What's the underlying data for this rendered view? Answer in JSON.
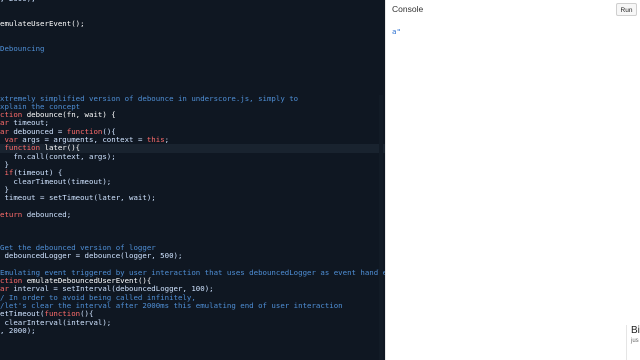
{
  "editor": {
    "lines": [
      {
        "parts": [
          {
            "t": ", 2000);",
            "c": "plain"
          }
        ]
      },
      {
        "parts": [
          {
            "t": "",
            "c": "plain"
          }
        ]
      },
      {
        "parts": [
          {
            "t": "",
            "c": "plain"
          }
        ]
      },
      {
        "parts": [
          {
            "t": "emulateUserEvent();",
            "c": "fn"
          }
        ]
      },
      {
        "parts": [
          {
            "t": "",
            "c": "plain"
          }
        ]
      },
      {
        "parts": [
          {
            "t": "",
            "c": "plain"
          }
        ]
      },
      {
        "parts": [
          {
            "t": "Debouncing",
            "c": "comment"
          }
        ]
      },
      {
        "parts": [
          {
            "t": "",
            "c": "plain"
          }
        ]
      },
      {
        "parts": [
          {
            "t": "",
            "c": "plain"
          }
        ]
      },
      {
        "parts": [
          {
            "t": "",
            "c": "plain"
          }
        ]
      },
      {
        "parts": [
          {
            "t": "",
            "c": "plain"
          }
        ]
      },
      {
        "parts": [
          {
            "t": "",
            "c": "plain"
          }
        ]
      },
      {
        "parts": [
          {
            "t": "xtremely simplified version of debounce in underscore.js, simply to",
            "c": "comment"
          }
        ]
      },
      {
        "parts": [
          {
            "t": "xplain the concept",
            "c": "comment"
          }
        ]
      },
      {
        "parts": [
          {
            "t": "ction ",
            "c": "keyword"
          },
          {
            "t": "debounce(fn, wait) {",
            "c": "fn"
          }
        ]
      },
      {
        "parts": [
          {
            "t": "ar ",
            "c": "keyword"
          },
          {
            "t": "timeout;",
            "c": "var"
          }
        ]
      },
      {
        "parts": [
          {
            "t": "ar ",
            "c": "keyword"
          },
          {
            "t": "debounced = ",
            "c": "var"
          },
          {
            "t": "function",
            "c": "keyword"
          },
          {
            "t": "(){",
            "c": "plain"
          }
        ]
      },
      {
        "parts": [
          {
            "t": " var ",
            "c": "keyword"
          },
          {
            "t": "args = arguments, context = ",
            "c": "var"
          },
          {
            "t": "this",
            "c": "keyword"
          },
          {
            "t": ";",
            "c": "plain"
          }
        ]
      },
      {
        "parts": [
          {
            "t": " function ",
            "c": "keyword"
          },
          {
            "t": "later(){",
            "c": "fn"
          }
        ],
        "active": true
      },
      {
        "parts": [
          {
            "t": "   fn.call(context, args);",
            "c": "var"
          }
        ]
      },
      {
        "parts": [
          {
            "t": " }",
            "c": "plain"
          }
        ]
      },
      {
        "parts": [
          {
            "t": " if",
            "c": "keyword"
          },
          {
            "t": "(timeout) {",
            "c": "var"
          }
        ]
      },
      {
        "parts": [
          {
            "t": "   clearTimeout(timeout);",
            "c": "var"
          }
        ]
      },
      {
        "parts": [
          {
            "t": " }",
            "c": "plain"
          }
        ]
      },
      {
        "parts": [
          {
            "t": " timeout = setTimeout(later, wait);",
            "c": "var"
          }
        ]
      },
      {
        "parts": [
          {
            "t": "",
            "c": "plain"
          }
        ]
      },
      {
        "parts": [
          {
            "t": "eturn ",
            "c": "keyword"
          },
          {
            "t": "debounced;",
            "c": "var"
          }
        ]
      },
      {
        "parts": [
          {
            "t": "",
            "c": "plain"
          }
        ]
      },
      {
        "parts": [
          {
            "t": "",
            "c": "plain"
          }
        ]
      },
      {
        "parts": [
          {
            "t": "",
            "c": "plain"
          }
        ]
      },
      {
        "parts": [
          {
            "t": "Get the debounced version of logger",
            "c": "comment"
          }
        ]
      },
      {
        "parts": [
          {
            "t": " debouncedLogger = debounce(logger, 500);",
            "c": "var"
          }
        ]
      },
      {
        "parts": [
          {
            "t": "",
            "c": "plain"
          }
        ]
      },
      {
        "parts": [
          {
            "t": "Emulating event triggered by user interaction that uses debouncedLogger as event handler",
            "c": "comment"
          }
        ]
      },
      {
        "parts": [
          {
            "t": "ction ",
            "c": "keyword"
          },
          {
            "t": "emulateDebouncedUserEvent(){",
            "c": "fn"
          }
        ]
      },
      {
        "parts": [
          {
            "t": "ar ",
            "c": "keyword"
          },
          {
            "t": "interval = setInterval(debouncedLogger, 100);",
            "c": "var"
          }
        ]
      },
      {
        "parts": [
          {
            "t": "/ In order to avoid being called infinitely,",
            "c": "comment"
          }
        ]
      },
      {
        "parts": [
          {
            "t": "/let's clear the interval after 2000ms this emulating end of user interaction",
            "c": "comment"
          }
        ]
      },
      {
        "parts": [
          {
            "t": "etTimeout(",
            "c": "var"
          },
          {
            "t": "function",
            "c": "keyword"
          },
          {
            "t": "(){",
            "c": "plain"
          }
        ]
      },
      {
        "parts": [
          {
            "t": " clearInterval(interval);",
            "c": "var"
          }
        ]
      },
      {
        "parts": [
          {
            "t": ", 2000);",
            "c": "plain"
          }
        ]
      }
    ]
  },
  "console": {
    "title": "Console",
    "run_label": "Run",
    "output": "a\""
  },
  "toast": {
    "title": "Bi",
    "subtitle": "jus"
  }
}
